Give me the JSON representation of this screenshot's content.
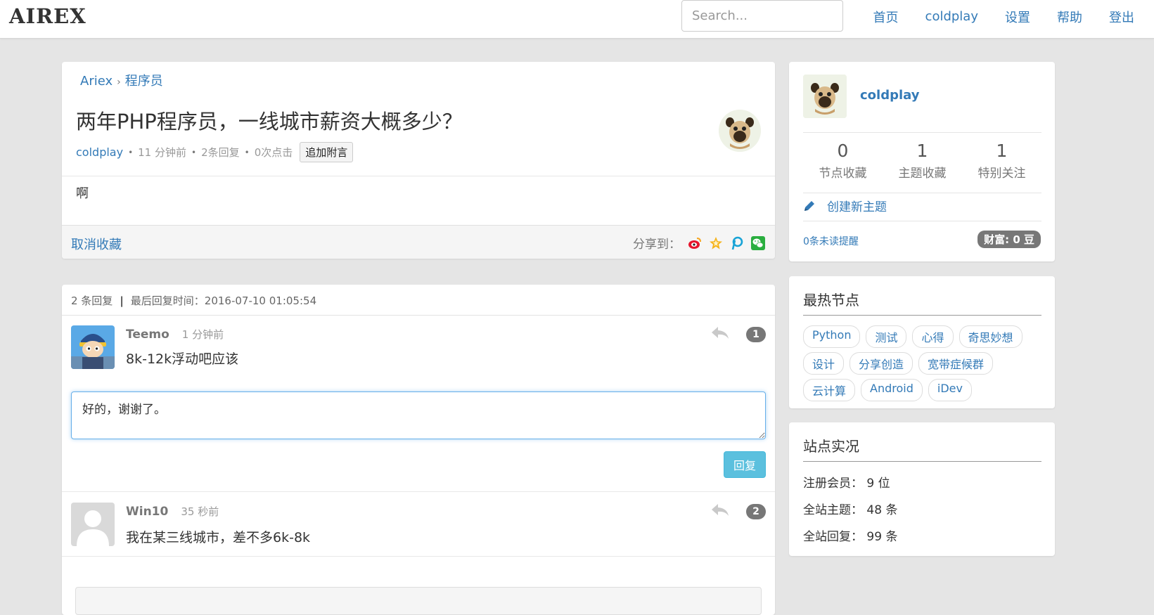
{
  "brand": "AIREX",
  "search": {
    "placeholder": "Search..."
  },
  "nav": [
    "首页",
    "coldplay",
    "设置",
    "帮助",
    "登出"
  ],
  "topic": {
    "breadcrumb": [
      "Ariex",
      "程序员"
    ],
    "title": "两年PHP程序员，一线城市薪资大概多少？",
    "author": "coldplay",
    "time": "11 分钟前",
    "replies": "2条回复",
    "clicks": "0次点击",
    "append_label": "追加附言",
    "body": "啊",
    "unfavorite": "取消收藏",
    "share_label": "分享到：",
    "share_icons": [
      "weibo-icon",
      "qzone-icon",
      "pinterest-icon",
      "wechat-icon"
    ]
  },
  "replies": {
    "count": "2 条回复",
    "last_reply": "最后回复时间：2016-07-10 01:05:54",
    "items": [
      {
        "name": "Teemo",
        "time": "1 分钟前",
        "text": "8k-12k浮动吧应该",
        "num": "1"
      },
      {
        "name": "Win10",
        "time": "35 秒前",
        "text": "我在某三线城市，差不多6k-8k",
        "num": "2"
      }
    ],
    "draft": "好的，谢谢了。",
    "reply_button": "回复"
  },
  "profile": {
    "name": "coldplay",
    "stats": [
      {
        "num": "0",
        "label": "节点收藏"
      },
      {
        "num": "1",
        "label": "主题收藏"
      },
      {
        "num": "1",
        "label": "特别关注"
      }
    ],
    "create": "创建新主题",
    "unread": "0条未读提醒",
    "wealth": "财富: 0 豆"
  },
  "hot": {
    "title": "最热节点",
    "tags": [
      "Python",
      "测试",
      "心得",
      "奇思妙想",
      "设计",
      "分享创造",
      "宽带症候群",
      "云计算",
      "Android",
      "iDev"
    ]
  },
  "site": {
    "title": "站点实况",
    "rows": [
      "注册会员： 9 位",
      "全站主题： 48 条",
      "全站回复： 99 条"
    ]
  },
  "colors": {
    "link": "#337ab7",
    "reply_button": "#5bc0de",
    "badge": "#777777"
  }
}
